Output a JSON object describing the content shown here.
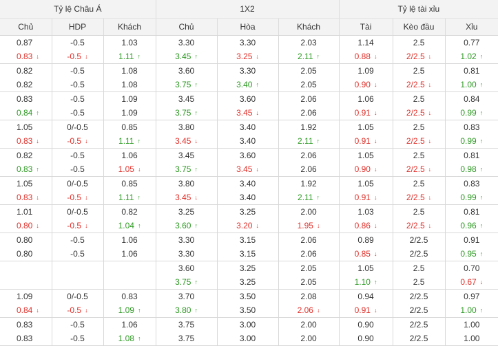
{
  "header": {
    "groups": [
      "Tỷ lệ Châu Á",
      "1X2",
      "Tỷ lệ tài xỉu"
    ],
    "columns": [
      "Chủ",
      "HDP",
      "Khách",
      "Chủ",
      "Hòa",
      "Khách",
      "Tài",
      "Kèo đầu",
      "Xỉu"
    ]
  },
  "colors": {
    "up": "#2e9a24",
    "down": "#e0302a",
    "header_bg": "#f3f3f3",
    "border": "#d8d8d8"
  },
  "rows": [
    [
      [
        "0.87",
        "0.83"
      ],
      [
        "-0.5",
        "-0.5"
      ],
      [
        "1.03",
        "1.11"
      ],
      [
        "3.30",
        "3.45"
      ],
      [
        "3.30",
        "3.25"
      ],
      [
        "2.03",
        "2.11"
      ],
      [
        "1.14",
        "0.88"
      ],
      [
        "2.5",
        "2/2.5"
      ],
      [
        "0.77",
        "1.02"
      ]
    ],
    [
      [
        "0.82",
        "0.82"
      ],
      [
        "-0.5",
        "-0.5"
      ],
      [
        "1.08",
        "1.08"
      ],
      [
        "3.60",
        "3.75"
      ],
      [
        "3.30",
        "3.40"
      ],
      [
        "2.05",
        "2.05"
      ],
      [
        "1.09",
        "0.90"
      ],
      [
        "2.5",
        "2/2.5"
      ],
      [
        "0.81",
        "1.00"
      ]
    ],
    [
      [
        "0.83",
        "0.84"
      ],
      [
        "-0.5",
        "-0.5"
      ],
      [
        "1.09",
        "1.09"
      ],
      [
        "3.45",
        "3.75"
      ],
      [
        "3.60",
        "3.45"
      ],
      [
        "2.06",
        "2.06"
      ],
      [
        "1.06",
        "0.91"
      ],
      [
        "2.5",
        "2/2.5"
      ],
      [
        "0.84",
        "0.99"
      ]
    ],
    [
      [
        "1.05",
        "0.83"
      ],
      [
        "0/-0.5",
        "-0.5"
      ],
      [
        "0.85",
        "1.11"
      ],
      [
        "3.80",
        "3.45"
      ],
      [
        "3.40",
        "3.40"
      ],
      [
        "1.92",
        "2.11"
      ],
      [
        "1.05",
        "0.91"
      ],
      [
        "2.5",
        "2/2.5"
      ],
      [
        "0.83",
        "0.99"
      ]
    ],
    [
      [
        "0.82",
        "0.83"
      ],
      [
        "-0.5",
        "-0.5"
      ],
      [
        "1.06",
        "1.05"
      ],
      [
        "3.45",
        "3.75"
      ],
      [
        "3.60",
        "3.45"
      ],
      [
        "2.06",
        "2.06"
      ],
      [
        "1.05",
        "0.90"
      ],
      [
        "2.5",
        "2/2.5"
      ],
      [
        "0.81",
        "0.98"
      ]
    ],
    [
      [
        "1.05",
        "0.83"
      ],
      [
        "0/-0.5",
        "-0.5"
      ],
      [
        "0.85",
        "1.11"
      ],
      [
        "3.80",
        "3.45"
      ],
      [
        "3.40",
        "3.40"
      ],
      [
        "1.92",
        "2.11"
      ],
      [
        "1.05",
        "0.91"
      ],
      [
        "2.5",
        "2/2.5"
      ],
      [
        "0.83",
        "0.99"
      ]
    ],
    [
      [
        "1.01",
        "0.80"
      ],
      [
        "0/-0.5",
        "-0.5"
      ],
      [
        "0.82",
        "1.04"
      ],
      [
        "3.25",
        "3.60"
      ],
      [
        "3.25",
        "3.20"
      ],
      [
        "2.00",
        "1.95"
      ],
      [
        "1.03",
        "0.86"
      ],
      [
        "2.5",
        "2/2.5"
      ],
      [
        "0.81",
        "0.96"
      ]
    ],
    [
      [
        "0.80",
        "0.80"
      ],
      [
        "-0.5",
        "-0.5"
      ],
      [
        "1.06",
        "1.06"
      ],
      [
        "3.30",
        "3.30"
      ],
      [
        "3.15",
        "3.15"
      ],
      [
        "2.06",
        "2.06"
      ],
      [
        "0.89",
        "0.85"
      ],
      [
        "2/2.5",
        "2/2.5"
      ],
      [
        "0.91",
        "0.95"
      ]
    ],
    [
      [
        "",
        ""
      ],
      [
        "",
        ""
      ],
      [
        "",
        ""
      ],
      [
        "3.60",
        "3.75"
      ],
      [
        "3.25",
        "3.25"
      ],
      [
        "2.05",
        "2.05"
      ],
      [
        "1.05",
        "1.10"
      ],
      [
        "2.5",
        "2.5"
      ],
      [
        "0.70",
        "0.67"
      ]
    ],
    [
      [
        "1.09",
        "0.84"
      ],
      [
        "0/-0.5",
        "-0.5"
      ],
      [
        "0.83",
        "1.09"
      ],
      [
        "3.70",
        "3.80"
      ],
      [
        "3.50",
        "3.50"
      ],
      [
        "2.08",
        "2.06"
      ],
      [
        "0.94",
        "0.91"
      ],
      [
        "2/2.5",
        "2/2.5"
      ],
      [
        "0.97",
        "1.00"
      ]
    ],
    [
      [
        "0.83",
        "0.83"
      ],
      [
        "-0.5",
        "-0.5"
      ],
      [
        "1.06",
        "1.08"
      ],
      [
        "3.75",
        "3.75"
      ],
      [
        "3.00",
        "3.00"
      ],
      [
        "2.00",
        "2.00"
      ],
      [
        "0.90",
        "0.90"
      ],
      [
        "2/2.5",
        "2/2.5"
      ],
      [
        "1.00",
        "1.00"
      ]
    ]
  ],
  "moves": [
    [
      "d",
      "d",
      "u",
      "u",
      "d",
      "u",
      "d",
      "d",
      "u"
    ],
    [
      "",
      "",
      "",
      "u",
      "u",
      "",
      "d",
      "d",
      "u"
    ],
    [
      "u",
      "",
      "",
      "u",
      "d",
      "",
      "d",
      "d",
      "u"
    ],
    [
      "d",
      "d",
      "u",
      "d",
      "",
      "u",
      "d",
      "d",
      "u"
    ],
    [
      "u",
      "",
      "d",
      "u",
      "d",
      "",
      "d",
      "d",
      "u"
    ],
    [
      "d",
      "d",
      "u",
      "d",
      "",
      "u",
      "d",
      "d",
      "u"
    ],
    [
      "d",
      "d",
      "u",
      "u",
      "d",
      "d",
      "d",
      "d",
      "u"
    ],
    [
      "",
      "",
      "",
      "",
      "",
      "",
      "d",
      "",
      "u"
    ],
    [
      "",
      "",
      "",
      "u",
      "",
      "",
      "u",
      "",
      "d"
    ],
    [
      "d",
      "d",
      "u",
      "u",
      "",
      "d",
      "d",
      "",
      "u"
    ],
    [
      "",
      "",
      "u",
      "",
      "",
      "",
      "",
      "",
      ""
    ]
  ],
  "arrow_glyphs": {
    "up": "↑",
    "down": "↓"
  }
}
